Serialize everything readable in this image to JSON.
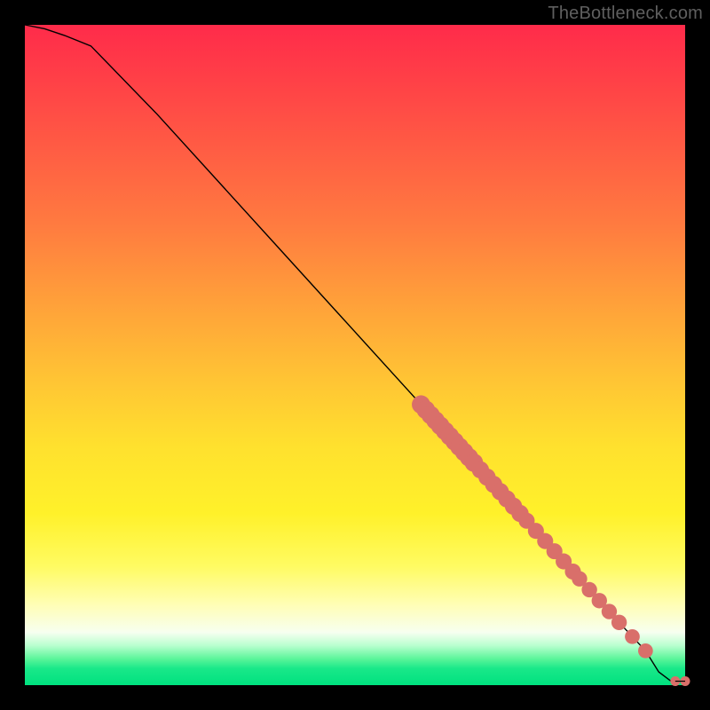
{
  "attribution": "TheBottleneck.com",
  "chart_data": {
    "type": "line",
    "title": "",
    "xlabel": "",
    "ylabel": "",
    "xlim": [
      0,
      100
    ],
    "ylim": [
      0,
      100
    ],
    "series": [
      {
        "name": "curve",
        "x": [
          0,
          3,
          6,
          10,
          20,
          30,
          40,
          50,
          60,
          70,
          80,
          90,
          94,
          96,
          98,
          100
        ],
        "y": [
          100,
          99.4,
          98.4,
          96.8,
          86.5,
          75.5,
          64.5,
          53.5,
          42.5,
          31.5,
          20.5,
          9.5,
          5.2,
          2.0,
          0.5,
          0.6
        ]
      }
    ],
    "point_clusters": [
      {
        "x_start": 60,
        "x_end": 68,
        "count": 12,
        "radius": 1.1
      },
      {
        "x_start": 68,
        "x_end": 75,
        "count": 8,
        "radius": 1.0
      },
      {
        "x_start": 76,
        "x_end": 83,
        "count": 6,
        "radius": 0.9
      },
      {
        "x_start": 84,
        "x_end": 90,
        "count": 5,
        "radius": 0.85
      },
      {
        "x_start": 92,
        "x_end": 94,
        "count": 2,
        "radius": 0.8
      }
    ],
    "tail_points": [
      {
        "x": 98.5,
        "y": 0.6
      },
      {
        "x": 100,
        "y": 0.6
      }
    ],
    "colors": {
      "curve_stroke": "#000000",
      "point_fill": "#d96f6a",
      "gradient_top": "#ff2b4a",
      "gradient_mid": "#ffe12e",
      "gradient_bottom": "#00e17f"
    }
  }
}
